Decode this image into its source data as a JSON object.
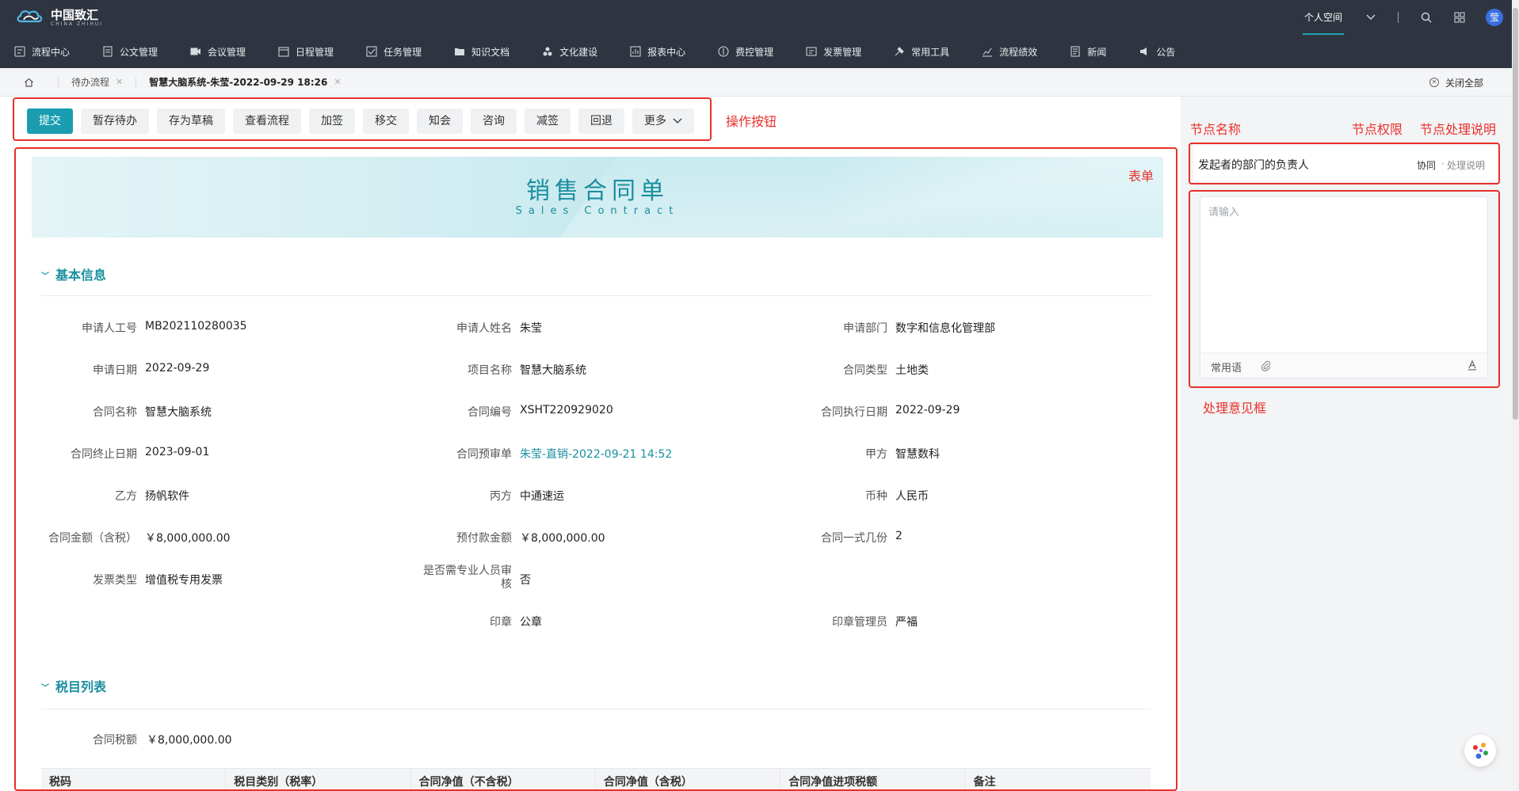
{
  "app": {
    "logo_text": "中国致汇",
    "logo_sub": "CHINA ZHIHUI"
  },
  "top": {
    "space_tab": "个人空间",
    "avatar": "莹"
  },
  "nav": [
    {
      "label": "流程中心",
      "icon": "flow-icon"
    },
    {
      "label": "公文管理",
      "icon": "document-icon"
    },
    {
      "label": "会议管理",
      "icon": "video-icon"
    },
    {
      "label": "日程管理",
      "icon": "calendar-icon"
    },
    {
      "label": "任务管理",
      "icon": "task-icon"
    },
    {
      "label": "知识文档",
      "icon": "folder-icon"
    },
    {
      "label": "文化建设",
      "icon": "culture-icon"
    },
    {
      "label": "报表中心",
      "icon": "report-icon"
    },
    {
      "label": "费控管理",
      "icon": "expense-icon"
    },
    {
      "label": "发票管理",
      "icon": "invoice-icon"
    },
    {
      "label": "常用工具",
      "icon": "tool-icon"
    },
    {
      "label": "流程绩效",
      "icon": "chart-icon"
    },
    {
      "label": "新闻",
      "icon": "news-icon"
    },
    {
      "label": "公告",
      "icon": "announce-icon"
    }
  ],
  "tabs": [
    {
      "label": "待办流程"
    },
    {
      "label": "智慧大脑系统-朱莹-2022-09-29 18:26"
    }
  ],
  "close_all": "关闭全部",
  "actions": [
    "提交",
    "暂存待办",
    "存为草稿",
    "查看流程",
    "加签",
    "移交",
    "知会",
    "咨询",
    "减签",
    "回退",
    "更多"
  ],
  "annotations": {
    "actions": "操作按钮",
    "form": "表单",
    "node_name": "节点名称",
    "node_perm": "节点权限",
    "node_explain": "节点处理说明",
    "opinion": "处理意见框"
  },
  "form": {
    "title": "销售合同单",
    "subtitle": "Sales Contract",
    "section_basic": "基本信息",
    "section_tax": "税目列表",
    "fields": [
      {
        "label": "申请人工号",
        "value": "MB202110280035"
      },
      {
        "label": "申请人姓名",
        "value": "朱莹"
      },
      {
        "label": "申请部门",
        "value": "数字和信息化管理部"
      },
      {
        "label": "申请日期",
        "value": "2022-09-29"
      },
      {
        "label": "项目名称",
        "value": "智慧大脑系统"
      },
      {
        "label": "合同类型",
        "value": "土地类"
      },
      {
        "label": "合同名称",
        "value": "智慧大脑系统"
      },
      {
        "label": "合同编号",
        "value": "XSHT220929020"
      },
      {
        "label": "合同执行日期",
        "value": "2022-09-29"
      },
      {
        "label": "合同终止日期",
        "value": "2023-09-01"
      },
      {
        "label": "合同预审单",
        "value": "朱莹-直销-2022-09-21 14:52"
      },
      {
        "label": "甲方",
        "value": "智慧数科"
      },
      {
        "label": "乙方",
        "value": "扬帆软件"
      },
      {
        "label": "丙方",
        "value": "中通速运"
      },
      {
        "label": "币种",
        "value": "人民币"
      },
      {
        "label": "合同金额（含税）",
        "value": "￥8,000,000.00"
      },
      {
        "label": "预付款金额",
        "value": "￥8,000,000.00"
      },
      {
        "label": "合同一式几份",
        "value": "2"
      },
      {
        "label": "发票类型",
        "value": "增值税专用发票"
      },
      {
        "label": "是否需专业人员审核",
        "value": "否"
      },
      {
        "label": "印章",
        "value": "公章"
      },
      {
        "label": "印章管理员",
        "value": "严福"
      }
    ],
    "tax_total_label": "合同税额",
    "tax_total_value": "￥8,000,000.00",
    "tax_columns": [
      "税码",
      "税目类别（税率）",
      "合同净值（不含税）",
      "合同净值（含税）",
      "合同净值进项税额",
      "备注"
    ]
  },
  "node": {
    "name": "发起者的部门的负责人",
    "permission": "协同",
    "explain": "处理说明"
  },
  "opinion": {
    "placeholder": "请输入",
    "common_phrase": "常用语"
  },
  "colors": {
    "accent": "#1a9db0",
    "annotation": "#e8302a",
    "topbar": "#2f3540"
  }
}
